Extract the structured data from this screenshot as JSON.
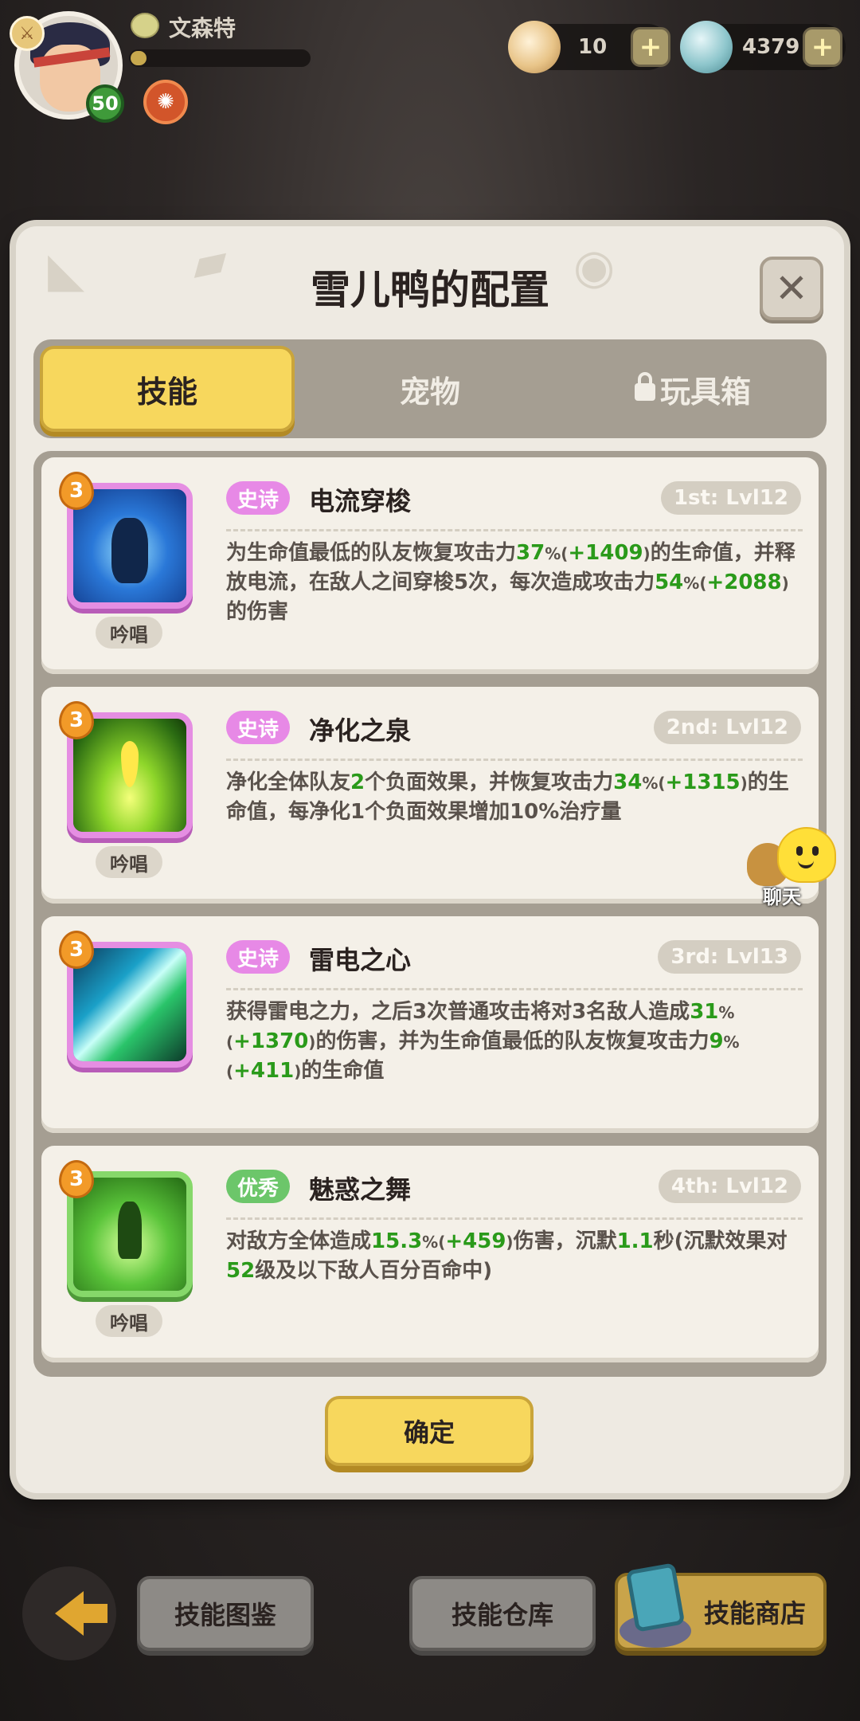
{
  "player": {
    "name": "文森特",
    "level": "50",
    "xp_fraction": 0.09
  },
  "currencies": [
    {
      "name": "shell",
      "value": "10",
      "color": "#e8c488"
    },
    {
      "name": "gem",
      "value": "4379",
      "color": "#8ec6cc"
    }
  ],
  "dialog": {
    "title": "雪儿鸭的配置",
    "tabs": [
      {
        "label": "技能",
        "active": true,
        "locked": false
      },
      {
        "label": "宠物",
        "active": false,
        "locked": false
      },
      {
        "label": "玩具箱",
        "active": false,
        "locked": true
      }
    ],
    "skills": [
      {
        "count": "3",
        "rarity": "史诗",
        "name": "电流穿梭",
        "slot": "1st: Lvl12",
        "chant": "吟唱",
        "icon": "lightning-creature-icon",
        "desc": [
          {
            "t": "为生命值最低的队友恢复攻击力"
          },
          {
            "t": "37",
            "g": true
          },
          {
            "t": "%(",
            "s": true
          },
          {
            "t": "+1409",
            "g": true
          },
          {
            "t": ")",
            "s": true
          },
          {
            "t": "的生命值，并释放电流，在敌人之间穿梭5次，每次造成攻击力"
          },
          {
            "t": "54",
            "g": true
          },
          {
            "t": "%(",
            "s": true
          },
          {
            "t": "+2088",
            "g": true
          },
          {
            "t": ")",
            "s": true
          },
          {
            "t": "的伤害"
          }
        ]
      },
      {
        "count": "3",
        "rarity": "史诗",
        "name": "净化之泉",
        "slot": "2nd: Lvl12",
        "chant": "吟唱",
        "icon": "spring-drop-icon",
        "desc": [
          {
            "t": "净化全体队友"
          },
          {
            "t": "2",
            "g": true
          },
          {
            "t": "个负面效果，并恢复攻击力"
          },
          {
            "t": "34",
            "g": true
          },
          {
            "t": "%(",
            "s": true
          },
          {
            "t": "+1315",
            "g": true
          },
          {
            "t": ")",
            "s": true
          },
          {
            "t": "的生命值，每净化1个负面效果增加10%治疗量"
          }
        ]
      },
      {
        "count": "3",
        "rarity": "史诗",
        "name": "雷电之心",
        "slot": "3rd: Lvl13",
        "chant": "",
        "icon": "thunder-strike-icon",
        "desc": [
          {
            "t": "获得雷电之力，之后3次普通攻击将对3名敌人造成"
          },
          {
            "t": "31",
            "g": true
          },
          {
            "t": "%(",
            "s": true
          },
          {
            "t": "+1370",
            "g": true
          },
          {
            "t": ")",
            "s": true
          },
          {
            "t": "的伤害，并为生命值最低的队友恢复攻击力"
          },
          {
            "t": "9",
            "g": true
          },
          {
            "t": "%(",
            "s": true
          },
          {
            "t": "+411",
            "g": true
          },
          {
            "t": ")",
            "s": true
          },
          {
            "t": "的生命值"
          }
        ]
      },
      {
        "count": "3",
        "rarity": "优秀",
        "name": "魅惑之舞",
        "slot": "4th: Lvl12",
        "chant": "吟唱",
        "icon": "charm-dance-icon",
        "desc": [
          {
            "t": "对敌方全体造成"
          },
          {
            "t": "15.3",
            "g": true
          },
          {
            "t": "%(",
            "s": true
          },
          {
            "t": "+459",
            "g": true
          },
          {
            "t": ")",
            "s": true
          },
          {
            "t": "伤害，沉默"
          },
          {
            "t": "1.1",
            "g": true
          },
          {
            "t": "秒(沉默效果对"
          },
          {
            "t": "52",
            "g": true
          },
          {
            "t": "级及以下敌人百分百命中)"
          }
        ]
      }
    ],
    "confirm_label": "确定"
  },
  "chat_label": "聊天",
  "bottom": {
    "back_label": "",
    "guide_label": "技能图鉴",
    "warehouse_label": "技能仓库",
    "shop_label": "技能商店"
  }
}
